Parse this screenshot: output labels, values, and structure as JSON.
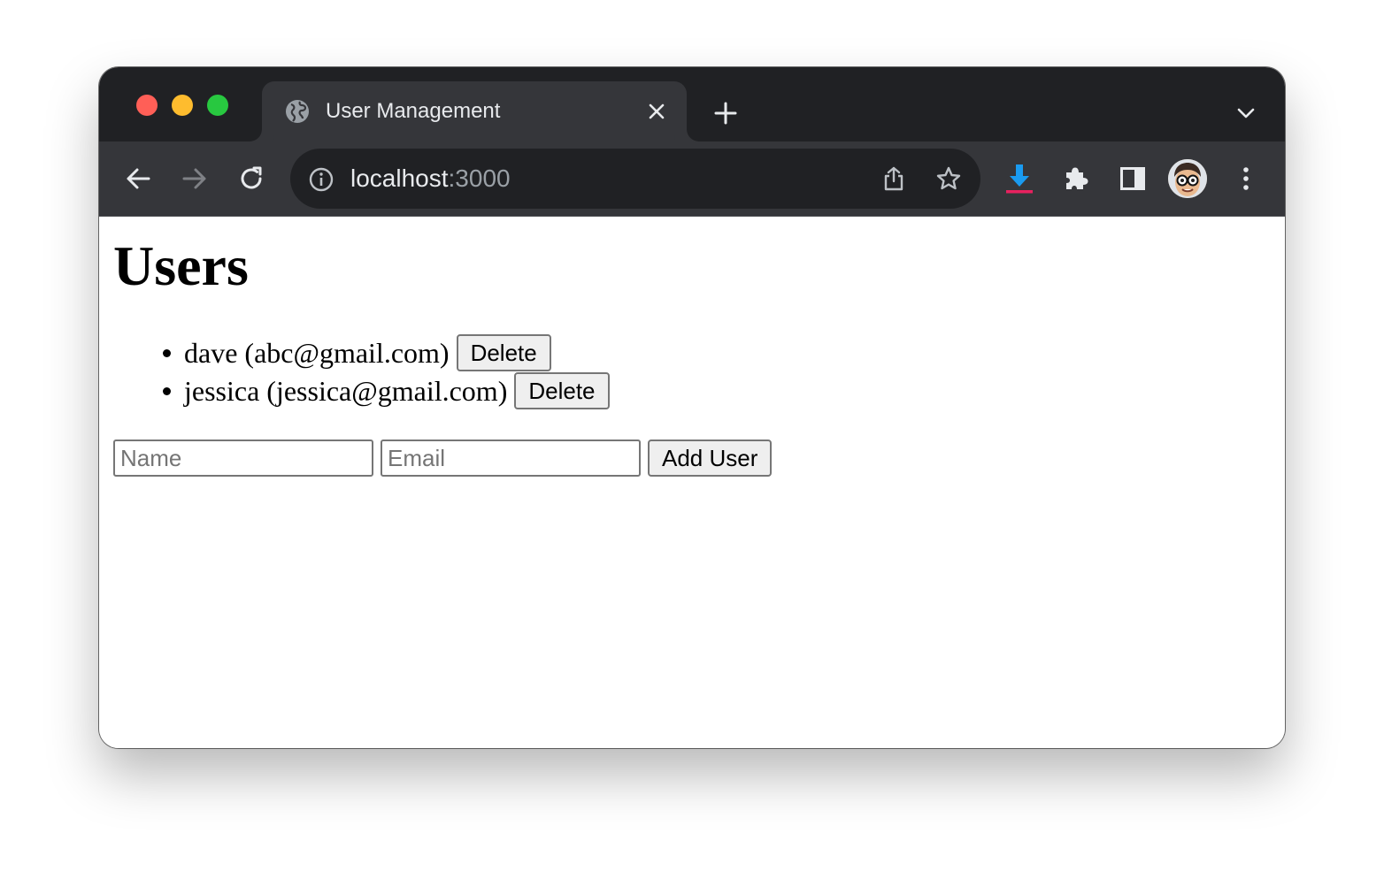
{
  "browser": {
    "tab": {
      "title": "User Management"
    },
    "address_bar": {
      "host": "localhost",
      "port": ":3000"
    },
    "colors": {
      "tabstrip_bg": "#202124",
      "toolbar_bg": "#35363a",
      "traffic_red": "#ff5f57",
      "traffic_yellow": "#febc2e",
      "traffic_green": "#28c840",
      "download_arrow": "#1a9bf0",
      "download_bar": "#e8215f"
    },
    "icons": {
      "favicon": "globe-icon",
      "close": "close-icon",
      "new_tab": "plus-icon",
      "tab_search": "chevron-down-icon",
      "back": "arrow-left-icon",
      "forward": "arrow-right-icon",
      "reload": "reload-icon",
      "site_info": "info-icon",
      "share": "share-icon",
      "bookmark": "star-icon",
      "downloads": "download-icon",
      "extensions": "puzzle-icon",
      "side_panel": "side-panel-icon",
      "profile": "avatar",
      "menu": "kebab-menu-icon"
    }
  },
  "page": {
    "heading": "Users",
    "users": [
      {
        "label": "dave (abc@gmail.com)",
        "delete_label": "Delete"
      },
      {
        "label": "jessica (jessica@gmail.com)",
        "delete_label": "Delete"
      }
    ],
    "form": {
      "name_placeholder": "Name",
      "name_value": "",
      "email_placeholder": "Email",
      "email_value": "",
      "submit_label": "Add User"
    }
  }
}
